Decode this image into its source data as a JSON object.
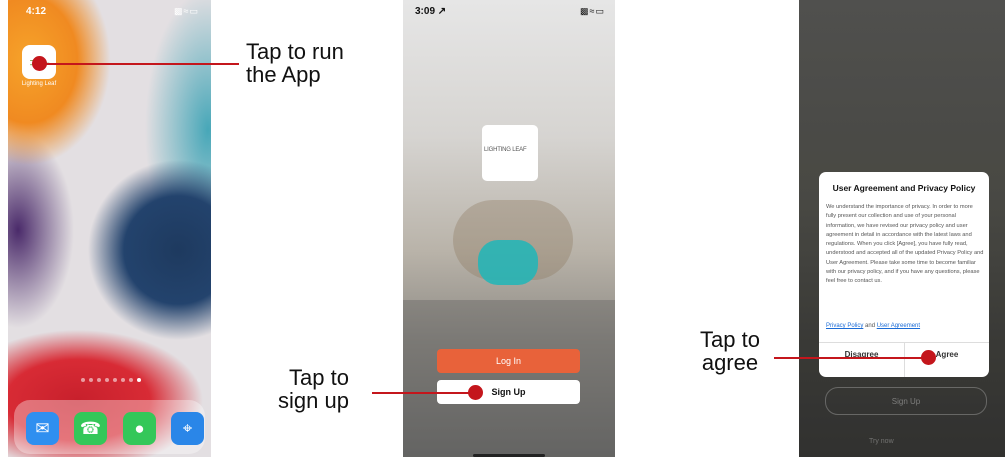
{
  "phone1": {
    "time": "4:12",
    "app_label": "Lighting Leaf",
    "app_icon_glyph": "⊃—",
    "dock_apps": [
      {
        "icon": "mail-icon",
        "glyph": "✉"
      },
      {
        "icon": "phone-icon",
        "glyph": "☎"
      },
      {
        "icon": "messages-icon",
        "glyph": "●"
      },
      {
        "icon": "safari-icon",
        "glyph": "⌖"
      }
    ],
    "page_dots": 8,
    "active_dot": 7
  },
  "phone2": {
    "time": "3:09 ↗",
    "logo_text": "LIGHTING LEAF",
    "login_label": "Log In",
    "signup_label": "Sign Up"
  },
  "phone3": {
    "dialog_title": "User Agreement and Privacy Policy",
    "dialog_body": "We understand the importance of privacy. In order to more fully present our collection and use of your personal information, we have revised our privacy policy and user agreement in detail in accordance with the latest laws and regulations. When you click [Agree], you have fully read, understood and accepted all of the updated Privacy Policy and User Agreement. Please take some time to become familiar with our privacy policy, and if you have any questions, please feel free to contact us.",
    "privacy_link": "Privacy Policy",
    "links_joiner": "and",
    "agreement_link": "User Agreement",
    "disagree_label": "Disagree",
    "agree_label": "Agree",
    "bg_signup_label": "Sign Up",
    "bg_try_label": "Try now"
  },
  "callouts": {
    "run_app": "Tap to run\nthe App",
    "sign_up": "Tap to\nsign up",
    "agree": "Tap to\nagree"
  },
  "colors": {
    "tap_marker": "#c4161c",
    "login_button": "#e8623a",
    "link": "#1a6bd6"
  }
}
